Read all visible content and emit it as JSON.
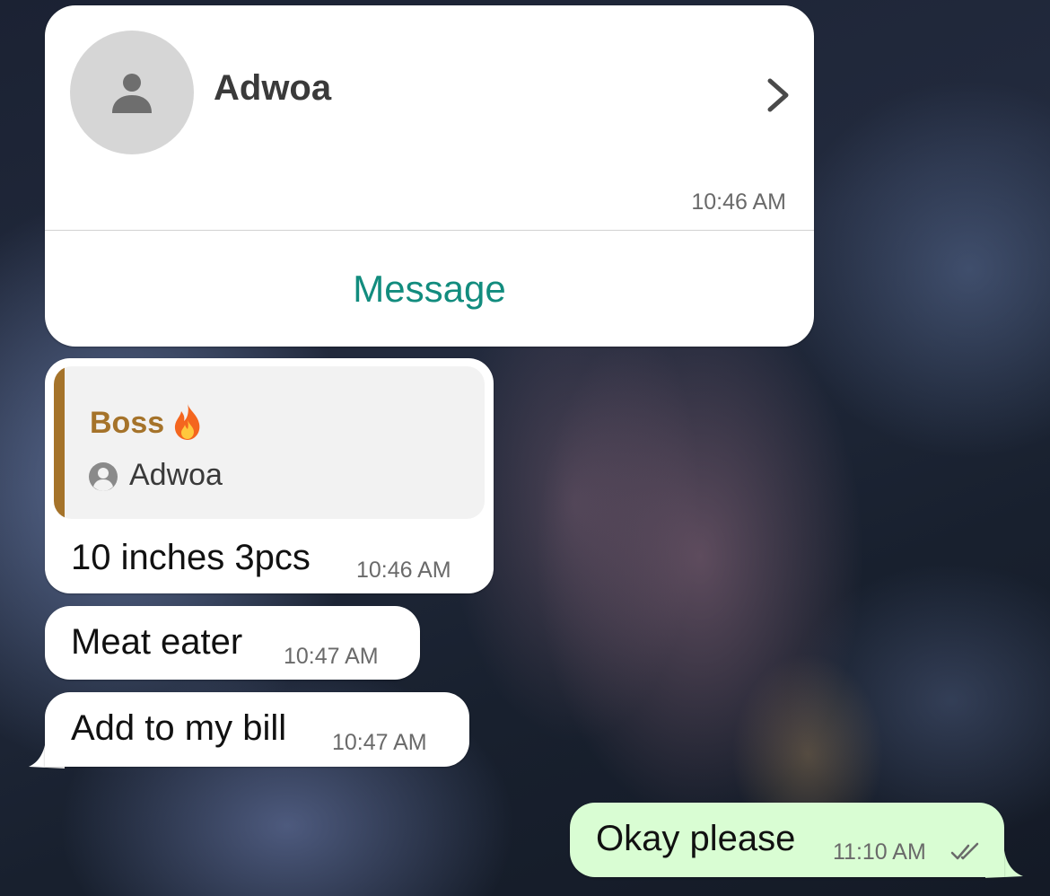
{
  "contact_card": {
    "name": "Adwoa",
    "time": "10:46 AM",
    "message_label": "Message",
    "avatar_icon": "person-icon",
    "chevron_icon": "chevron-right-icon",
    "action_color": "#128c7e"
  },
  "messages": [
    {
      "direction": "incoming",
      "quote": {
        "sender": "Boss",
        "sender_emoji_icon": "fire-icon",
        "sender_color": "#a5732a",
        "contact_icon": "person-circle-icon",
        "contact_name": "Adwoa"
      },
      "text": "10 inches 3pcs",
      "time": "10:46 AM"
    },
    {
      "direction": "incoming",
      "text": "Meat eater",
      "time": "10:47 AM"
    },
    {
      "direction": "incoming",
      "text": "Add to my bill",
      "time": "10:47 AM"
    },
    {
      "direction": "outgoing",
      "text": "Okay please",
      "time": "11:10 AM",
      "status_icon": "double-check-icon"
    }
  ],
  "colors": {
    "incoming_bubble": "#ffffff",
    "outgoing_bubble": "#d9fdd3",
    "read_ticks": "#6a6a6a"
  }
}
